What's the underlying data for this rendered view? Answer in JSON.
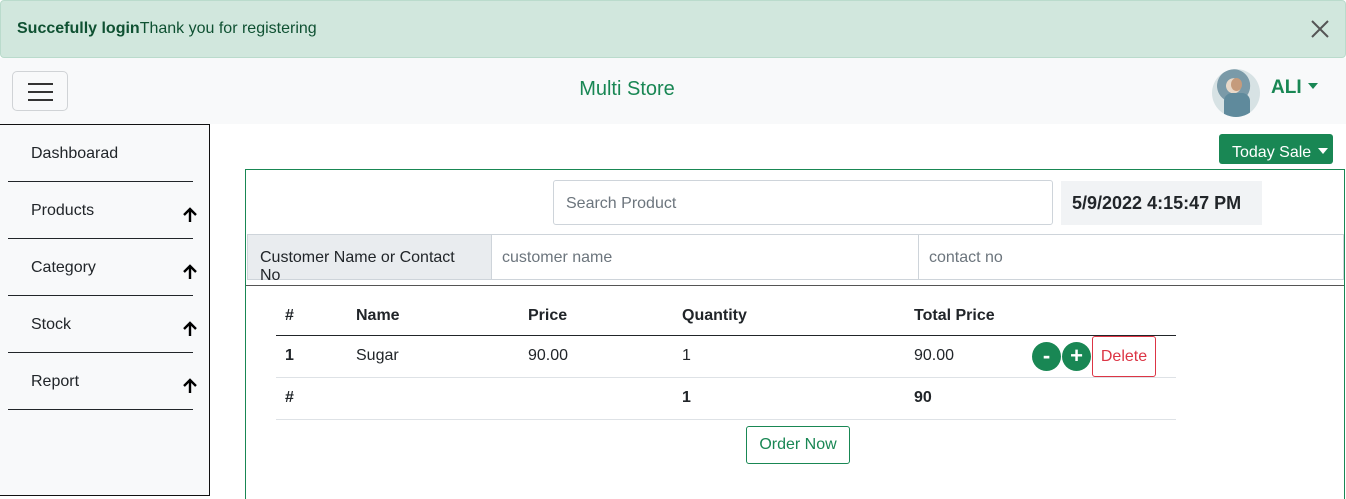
{
  "alert": {
    "strong": "Succefully login",
    "message": "Thank you for registering"
  },
  "navbar": {
    "brand": "Multi Store",
    "user": "ALI"
  },
  "sidebar": {
    "items": [
      {
        "label": "Dashboarad",
        "has_arrow": false
      },
      {
        "label": "Products",
        "has_arrow": true
      },
      {
        "label": "Category",
        "has_arrow": true
      },
      {
        "label": "Stock",
        "has_arrow": true
      },
      {
        "label": "Report",
        "has_arrow": true
      }
    ]
  },
  "toolbar": {
    "today_sale": "Today Sale"
  },
  "search": {
    "placeholder": "Search Product"
  },
  "datetime": "5/9/2022 4:15:47 PM",
  "customer": {
    "label": "Customer Name or Contact No",
    "name_placeholder": "customer name",
    "contact_placeholder": "contact no"
  },
  "table": {
    "headers": [
      "#",
      "Name",
      "Price",
      "Quantity",
      "Total Price"
    ],
    "rows": [
      {
        "num": "1",
        "name": "Sugar",
        "price": "90.00",
        "qty": "1",
        "total": "90.00"
      }
    ],
    "summary": {
      "num": "#",
      "qty": "1",
      "total": "90"
    },
    "minus_label": "-",
    "plus_label": "+",
    "delete_label": "Delete"
  },
  "order_button": "Order Now",
  "colors": {
    "primary": "#198754",
    "danger": "#dc3545",
    "alert_bg": "#d1e7dd"
  }
}
